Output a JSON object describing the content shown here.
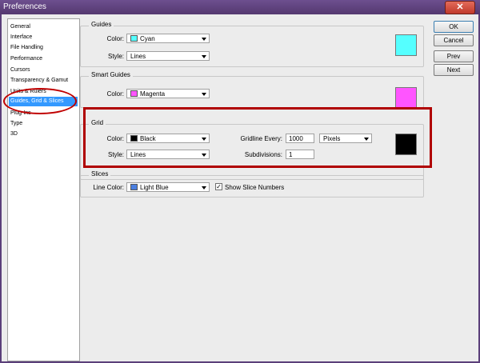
{
  "window": {
    "title": "Preferences",
    "close_glyph": "✕"
  },
  "nav": {
    "items": [
      {
        "label": "General"
      },
      {
        "label": "Interface"
      },
      {
        "label": "File Handling"
      },
      {
        "label": "Performance"
      },
      {
        "label": "Cursors"
      },
      {
        "label": "Transparency & Gamut"
      },
      {
        "label": "Units & Rulers"
      },
      {
        "label": "Guides, Grid & Slices",
        "selected": true
      },
      {
        "label": "Plug-Ins"
      },
      {
        "label": "Type"
      },
      {
        "label": "3D"
      }
    ]
  },
  "guides": {
    "legend": "Guides",
    "color_label": "Color:",
    "color_value": "Cyan",
    "color_hex": "#55ffff",
    "style_label": "Style:",
    "style_value": "Lines"
  },
  "smart_guides": {
    "legend": "Smart Guides",
    "color_label": "Color:",
    "color_value": "Magenta",
    "color_hex": "#ff55ff"
  },
  "grid": {
    "legend": "Grid",
    "color_label": "Color:",
    "color_value": "Black",
    "color_hex": "#000000",
    "style_label": "Style:",
    "style_value": "Lines",
    "gridline_label": "Gridline Every:",
    "gridline_value": "1000",
    "unit_value": "Pixels",
    "subdivisions_label": "Subdivisions:",
    "subdivisions_value": "1"
  },
  "slices": {
    "legend": "Slices",
    "line_color_label": "Line Color:",
    "line_color_value": "Light Blue",
    "line_color_hex": "#4b7fe0",
    "show_numbers_label": "Show Slice Numbers",
    "show_numbers_checked": true,
    "check_glyph": "✓"
  },
  "buttons": {
    "ok": "OK",
    "cancel": "Cancel",
    "prev": "Prev",
    "next": "Next"
  },
  "annotation_color": "#b00000"
}
